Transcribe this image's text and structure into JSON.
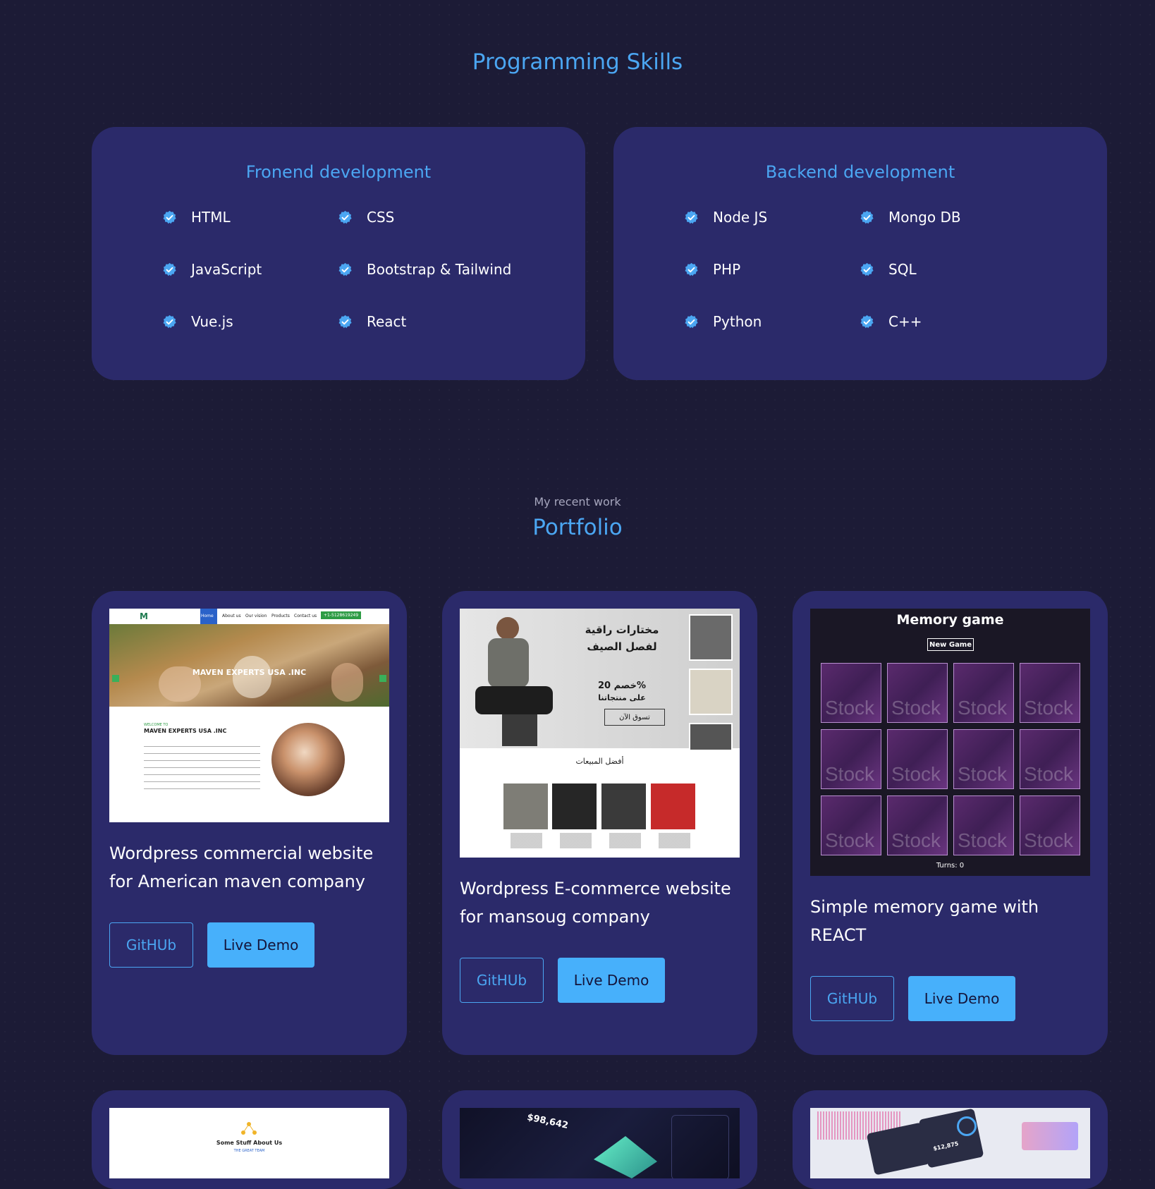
{
  "skills": {
    "title": "Programming Skills",
    "frontend": {
      "title": "Fronend development",
      "items": [
        "HTML",
        "CSS",
        "JavaScript",
        "Bootstrap & Tailwind",
        "Vue.js",
        "React"
      ]
    },
    "backend": {
      "title": "Backend development",
      "items": [
        "Node JS",
        "Mongo DB",
        "PHP",
        "SQL",
        "Python",
        "C++"
      ]
    }
  },
  "portfolio": {
    "subtitle": "My recent work",
    "title": "Portfolio",
    "github_label": "GitHUb",
    "demo_label": "Live Demo",
    "projects": [
      {
        "title": "Wordpress commercial website for American maven company",
        "shot": {
          "nav": [
            "Home",
            "About us",
            "Our vision",
            "Products",
            "Contact us"
          ],
          "phone": "+1-5128619249",
          "hero": "MAVEN EXPERTS USA .INC",
          "welcome": "WELCOME TO",
          "heading": "MAVEN EXPERTS USA .INC"
        }
      },
      {
        "title": "Wordpress E-commerce website for mansoug company",
        "shot": {
          "headline": "مختارات راقية لفصل الصيف",
          "discount": "خصم 20%",
          "discount2": "على منتجاتنا",
          "shop": "تسوق الآن",
          "bestsellers": "أفضل المبيعات"
        }
      },
      {
        "title": "Simple memory game with REACT",
        "shot": {
          "title": "Memory game",
          "new_game": "New Game",
          "tile_text": "Stock",
          "turns": "Turns: 0"
        }
      }
    ],
    "lower_shots": {
      "about": "Some Stuff About Us",
      "team": "THE GREAT TEAM",
      "amount1": "$98,642",
      "amount2": "$12,875"
    }
  },
  "colors": {
    "background": "#1c1b36",
    "card": "#2b2a6a",
    "accent": "#4ba6f2",
    "button_fill": "#47b0fb"
  },
  "icons": {
    "skill_check": "verified-check-icon"
  }
}
